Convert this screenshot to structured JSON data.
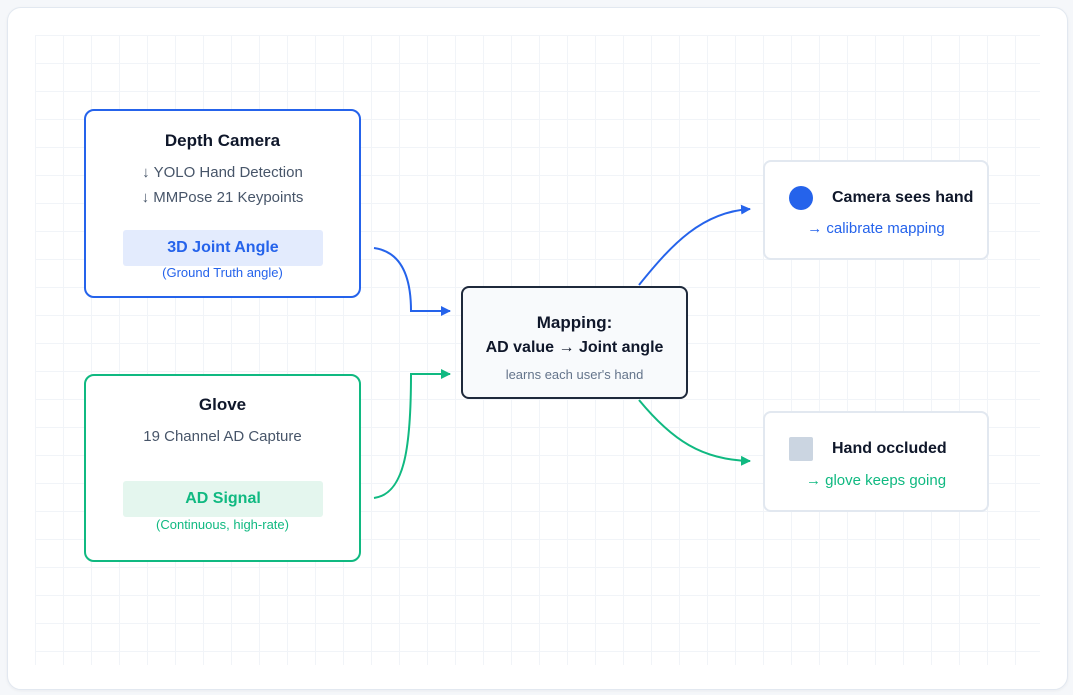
{
  "nodes": {
    "depth_camera": {
      "title": "Depth Camera",
      "steps": [
        "↓ YOLO Hand Detection",
        "↓ MMPose 21 Keypoints"
      ],
      "output_label": "3D Joint Angle",
      "output_note": "(Ground Truth angle)"
    },
    "glove": {
      "title": "Glove",
      "steps": [
        "19 Channel AD Capture"
      ],
      "output_label": "AD Signal",
      "output_note": "(Continuous, high-rate)"
    },
    "mapping": {
      "title": "Mapping:",
      "subtitle": "AD value → Joint angle",
      "note": "learns each user's hand"
    },
    "camera_sees_hand": {
      "title": "Camera sees hand",
      "action": "→ calibrate mapping",
      "icon": "filled-circle"
    },
    "hand_occluded": {
      "title": "Hand occluded",
      "action": "→ glove keeps going",
      "icon": "filled-square"
    }
  },
  "edges": [
    {
      "from": "depth_camera",
      "to": "mapping",
      "color": "blue"
    },
    {
      "from": "glove",
      "to": "mapping",
      "color": "green"
    },
    {
      "from": "mapping",
      "to": "camera_sees_hand",
      "color": "blue"
    },
    {
      "from": "mapping",
      "to": "hand_occluded",
      "color": "green"
    }
  ],
  "colors": {
    "blue": "#2563eb",
    "green": "#10b981",
    "navy": "#1e293b"
  }
}
